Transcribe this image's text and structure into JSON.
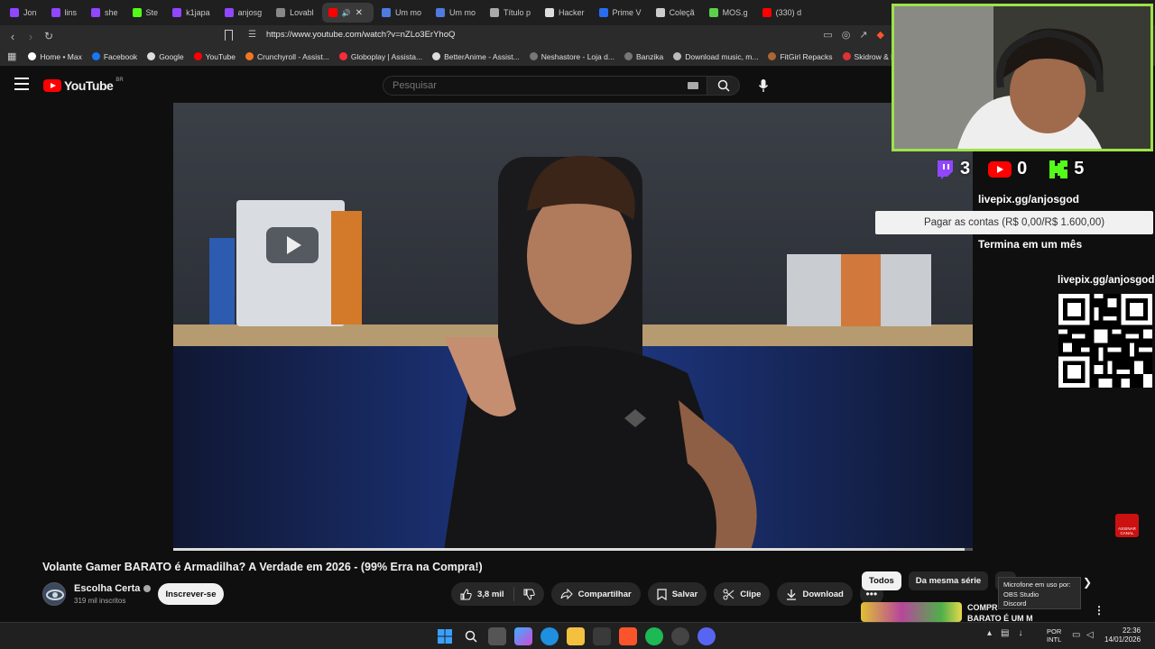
{
  "browser": {
    "tabs": [
      {
        "label": "Jon",
        "color": "#9146ff"
      },
      {
        "label": "lins",
        "color": "#9146ff"
      },
      {
        "label": "she",
        "color": "#9146ff"
      },
      {
        "label": "Ste",
        "color": "#53fc18"
      },
      {
        "label": "k1japa",
        "color": "#9146ff"
      },
      {
        "label": "anjosg",
        "color": "#9146ff"
      },
      {
        "label": "Lovabl",
        "color": "#888888"
      },
      {
        "label": "",
        "color": "#ff0000",
        "active": true
      },
      {
        "label": "Um mo",
        "color": "#4f7ae0"
      },
      {
        "label": "Um mo",
        "color": "#4f7ae0"
      },
      {
        "label": "Título p",
        "color": "#aaaaaa"
      },
      {
        "label": "Hacker",
        "color": "#dddddd"
      },
      {
        "label": "Prime V",
        "color": "#2a6cf0"
      },
      {
        "label": "Coleçã",
        "color": "#cccccc"
      },
      {
        "label": "MOS.g",
        "color": "#5bd14a"
      },
      {
        "label": "(330) d",
        "color": "#ff0000"
      }
    ],
    "url": "https://www.youtube.com/watch?v=nZLo3ErYhoQ",
    "bookmarks": [
      {
        "label": "Home • Max",
        "color": "#ffffff"
      },
      {
        "label": "Facebook",
        "color": "#1877f2"
      },
      {
        "label": "Google",
        "color": "#dddddd"
      },
      {
        "label": "YouTube",
        "color": "#ff0000"
      },
      {
        "label": "Crunchyroll - Assist...",
        "color": "#f47521"
      },
      {
        "label": "Globoplay | Assista...",
        "color": "#fb2b3a"
      },
      {
        "label": "BetterAnime - Assist...",
        "color": "#dddddd"
      },
      {
        "label": "Neshastore - Loja d...",
        "color": "#777777"
      },
      {
        "label": "Banzika",
        "color": "#777777"
      },
      {
        "label": "Download music, m...",
        "color": "#bbbbbb"
      },
      {
        "label": "FitGirl Repacks",
        "color": "#aa6633"
      },
      {
        "label": "Skidrow & Relo",
        "color": "#dd3333"
      }
    ]
  },
  "youtube": {
    "logo_text": "YouTube",
    "region": "BR",
    "search_placeholder": "Pesquisar"
  },
  "video": {
    "progress": 0.99,
    "title": "Volante Gamer BARATO é Armadilha? A Verdade em 2026 - (99% Erra na Compra!)",
    "channel": "Escolha Certa",
    "subscribers": "319 mil inscritos",
    "subscribe_label": "Inscrever-se",
    "likes": "3,8 mil",
    "share_label": "Compartilhar",
    "save_label": "Salvar",
    "clip_label": "Clipe",
    "download_label": "Download",
    "watermark_label": "ASSINAR CANAL"
  },
  "overlay": {
    "twitch_count": "3",
    "youtube_count": "0",
    "kick_count": "5",
    "livepix_url": "livepix.gg/anjosgod",
    "goal_text": "Pagar as contas (R$ 0,00/R$ 1.600,00)",
    "goal_end": "Termina em um mês",
    "qr_url": "livepix.gg/anjosgod"
  },
  "sidebar": {
    "chips": [
      "Todos",
      "Da mesma série",
      "D"
    ],
    "recommendation_title_line1": "COMPR",
    "recommendation_title_line2": "BARATO É UM M",
    "tooltip_line1": "Microfone em uso por:",
    "tooltip_line2": "OBS Studio",
    "tooltip_line3": "Discord"
  },
  "taskbar": {
    "lang_line1": "POR",
    "lang_line2": "INTL",
    "time": "22:36",
    "date": "14/01/2026"
  }
}
